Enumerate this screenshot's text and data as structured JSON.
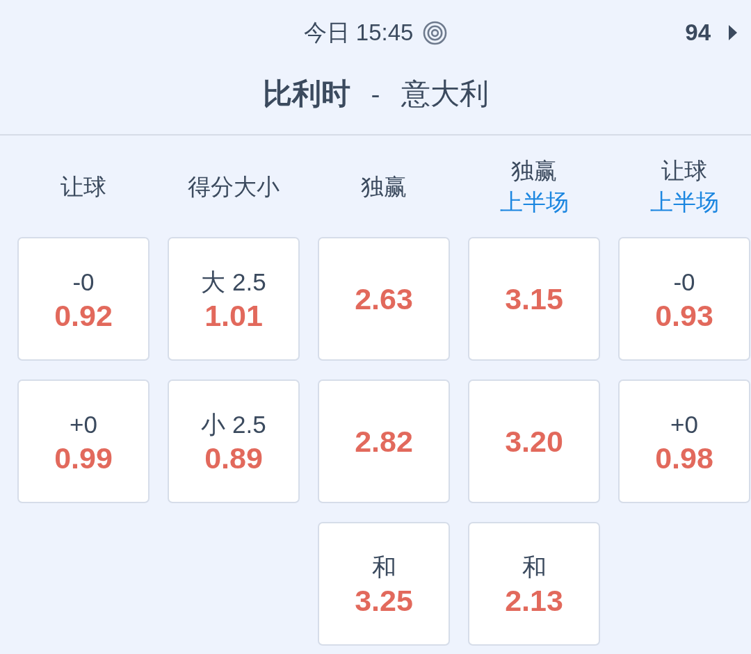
{
  "status": {
    "time": "今日 15:45",
    "count": "94"
  },
  "match": {
    "home": "比利时",
    "separator": "-",
    "away": "意大利"
  },
  "markets": [
    {
      "title": "让球",
      "outcomes": [
        {
          "label": "-0",
          "odds": "0.92"
        },
        {
          "label": "+0",
          "odds": "0.99"
        }
      ]
    },
    {
      "title": "得分大小",
      "outcomes": [
        {
          "label": "大 2.5",
          "odds": "1.01"
        },
        {
          "label": "小 2.5",
          "odds": "0.89"
        }
      ]
    },
    {
      "title": "独赢",
      "outcomes": [
        {
          "odds": "2.63"
        },
        {
          "odds": "2.82"
        },
        {
          "label": "和",
          "odds": "3.25"
        }
      ]
    },
    {
      "title": "独赢",
      "period": "上半场",
      "outcomes": [
        {
          "odds": "3.15"
        },
        {
          "odds": "3.20"
        },
        {
          "label": "和",
          "odds": "2.13"
        }
      ]
    },
    {
      "title": "让球",
      "period": "上半场",
      "outcomes": [
        {
          "label": "-0",
          "odds": "0.93"
        },
        {
          "label": "+0",
          "odds": "0.98"
        }
      ]
    }
  ]
}
